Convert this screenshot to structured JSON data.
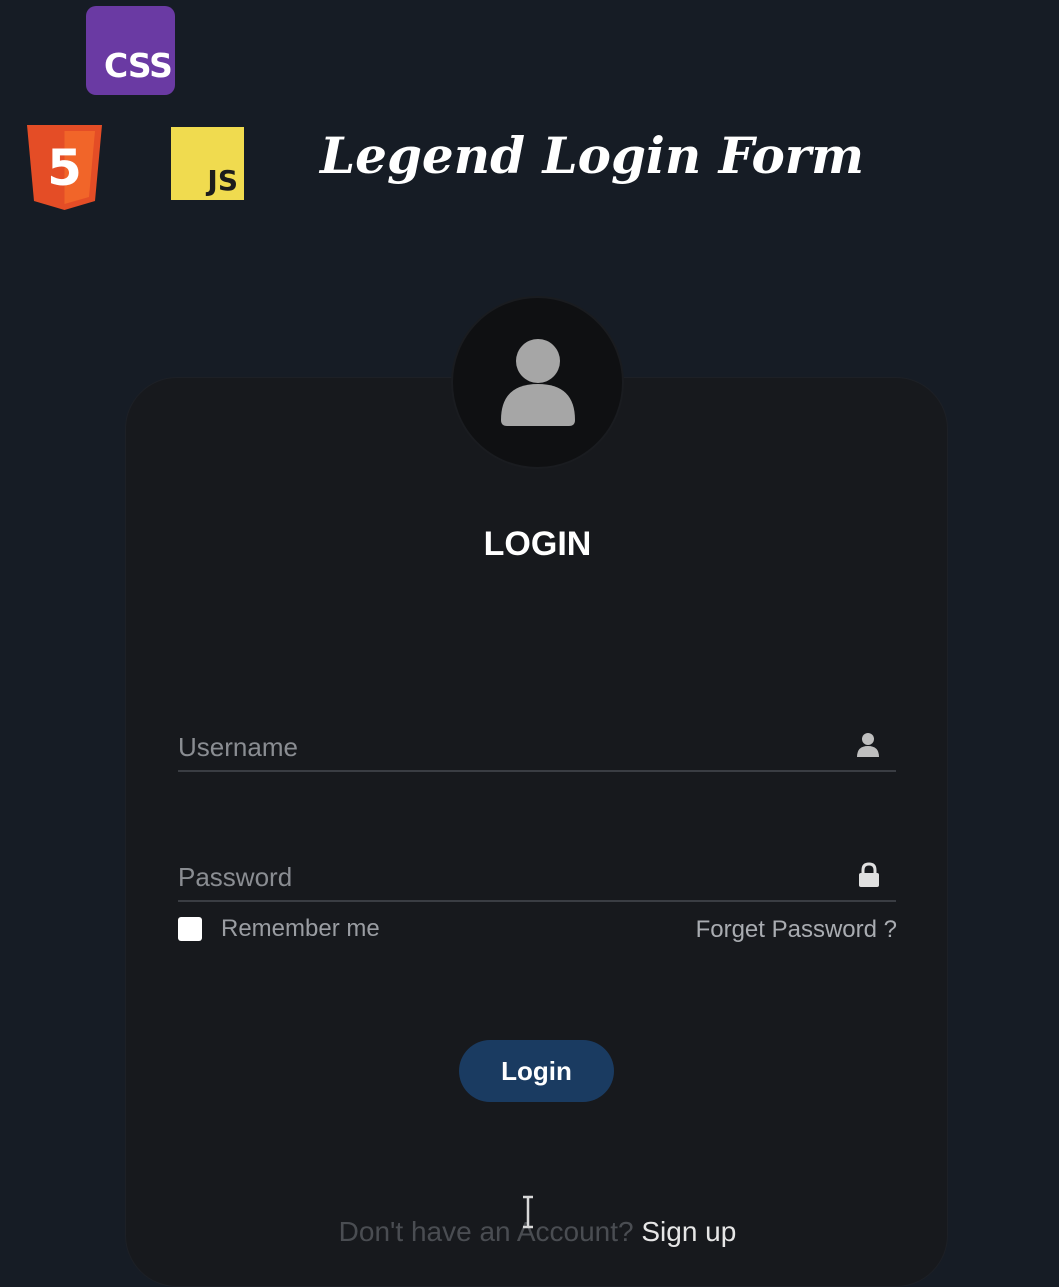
{
  "badges": {
    "css_label": "CSS",
    "html5_label": "5",
    "js_label": "JS"
  },
  "header": {
    "title": "Legend Login Form"
  },
  "card": {
    "avatar_icon": "user-silhouette-icon",
    "heading": "LOGIN",
    "username": {
      "placeholder": "Username",
      "value": "",
      "icon": "user-icon"
    },
    "password": {
      "placeholder": "Password",
      "value": "",
      "icon": "lock-icon"
    },
    "remember_label": "Remember me",
    "remember_checked": false,
    "forgot_label": "Forget Password ?",
    "login_button_label": "Login",
    "signup_prompt": "Don't have an Account?",
    "signup_link_label": "Sign up"
  },
  "colors": {
    "page_background": "#161c25",
    "card_background": "#17191d",
    "login_button": "#1a3b61",
    "css_badge": "#6a3aa3",
    "html5_badge": "#e44d26",
    "js_badge": "#f0db4f"
  }
}
